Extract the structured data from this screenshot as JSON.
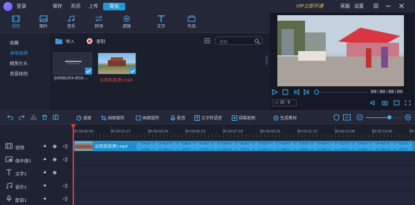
{
  "titlebar": {
    "login": "登录",
    "menu": [
      "保存",
      "关闭",
      "上传"
    ],
    "export": "导出",
    "vip": "VIP立即开通",
    "service": "客服",
    "settings": "设置"
  },
  "tooltabs": [
    {
      "label": "视频",
      "icon": "video-icon",
      "active": true
    },
    {
      "label": "图片",
      "icon": "image-icon",
      "active": false
    },
    {
      "label": "音乐",
      "icon": "music-icon",
      "active": false
    },
    {
      "label": "转场",
      "icon": "transition-icon",
      "active": false
    },
    {
      "label": "滤镜",
      "icon": "filter-icon",
      "active": false
    },
    {
      "label": "文字",
      "icon": "text-icon",
      "active": false
    },
    {
      "label": "作品",
      "icon": "works-icon",
      "active": false
    }
  ],
  "library": {
    "side": [
      "收藏",
      "本地视频",
      "精美片头",
      "背景样例"
    ],
    "active_side": 1,
    "import": "导入",
    "record": "录制",
    "search_placeholder": "搜索",
    "items": [
      {
        "caption": "{b658b204-8f16-...",
        "checked": true
      },
      {
        "caption": "云南旅游(新).mp4",
        "checked": true
      }
    ]
  },
  "preview": {
    "time": "00:00:00:00",
    "ratio": "16 : 9"
  },
  "timeline_toolbar": [
    "调速",
    "画面裁剪",
    "画面旋转",
    "配音",
    "文字转语音",
    "绿幕抠图",
    "生成素材"
  ],
  "ruler": [
    "00:00:00:00",
    "00:00:01:27",
    "00:00:03:24",
    "00:00:05:21",
    "00:00:07:18",
    "00:00:09:15",
    "00:00:11:12",
    "00:00:13:09",
    "00:00:15:06",
    "00:00:17:0"
  ],
  "tracks": [
    {
      "name": "视频",
      "icon": "video-track-icon"
    },
    {
      "name": "画中画1",
      "icon": "pip-track-icon"
    },
    {
      "name": "文字1",
      "icon": "text-track-icon"
    },
    {
      "name": "音乐1",
      "icon": "music-track-icon"
    },
    {
      "name": "配音1",
      "icon": "dub-track-icon"
    }
  ],
  "clip": {
    "name": "云南旅游(新).mp4"
  },
  "colors": {
    "accent": "#2d9de4",
    "vip": "#f3c24a",
    "playhead": "#e23b3b"
  }
}
